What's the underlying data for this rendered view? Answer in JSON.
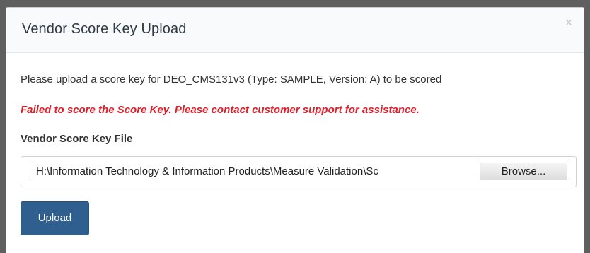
{
  "modal": {
    "title": "Vendor Score Key Upload",
    "close_glyph": "×"
  },
  "body": {
    "instruction": "Please upload a score key for DEO_CMS131v3 (Type: SAMPLE, Version: A) to be scored",
    "error": "Failed to score the Score Key. Please contact customer support for assistance.",
    "file_label": "Vendor Score Key File",
    "file_value": "H:\\Information Technology & Information Products\\Measure Validation\\Sc",
    "browse_label": "Browse...",
    "upload_label": "Upload"
  },
  "colors": {
    "error": "#e01f2a",
    "primary_button": "#2f5f8e",
    "title": "#2f3a45"
  },
  "icons": {
    "close": "close-icon"
  }
}
